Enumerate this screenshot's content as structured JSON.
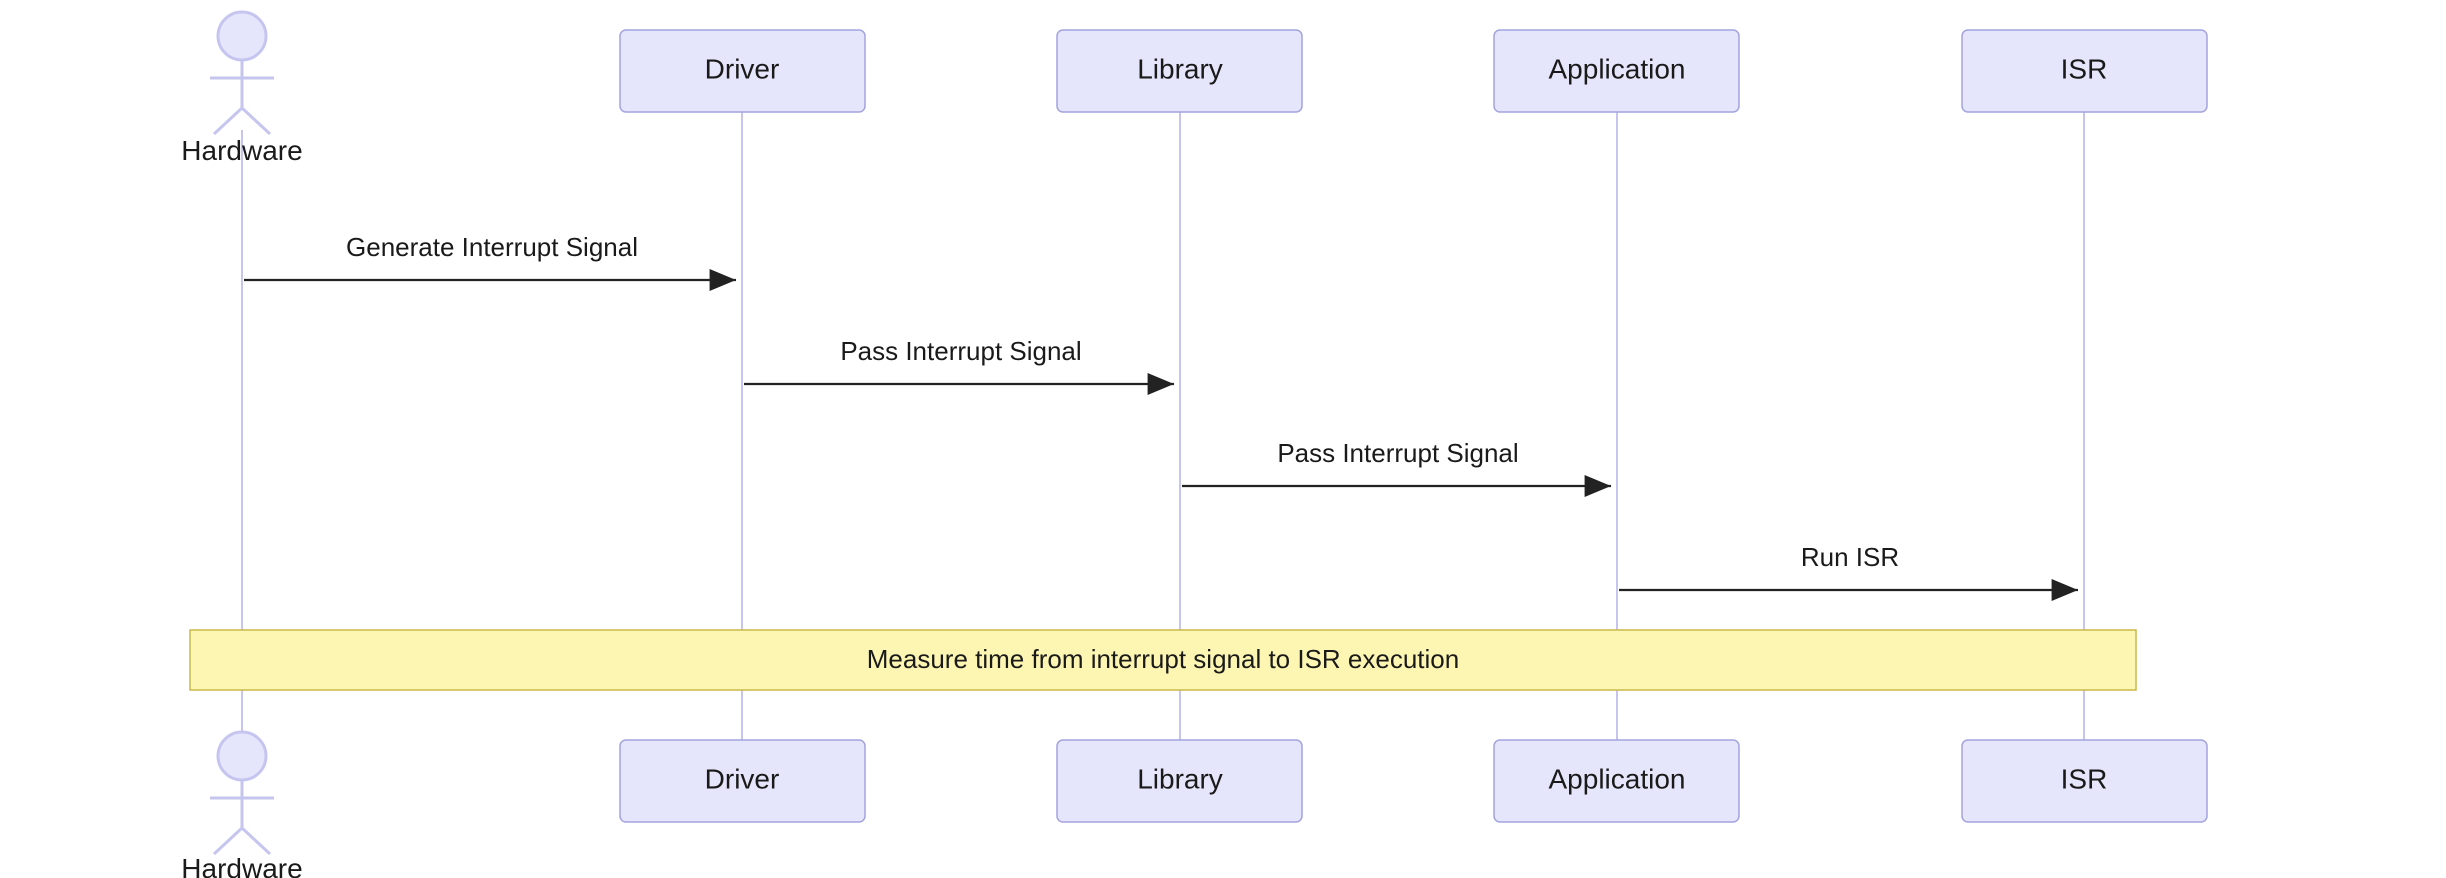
{
  "diagram": {
    "type": "sequence",
    "actor": {
      "name": "Hardware"
    },
    "participants": [
      {
        "id": "driver",
        "label": "Driver"
      },
      {
        "id": "library",
        "label": "Library"
      },
      {
        "id": "application",
        "label": "Application"
      },
      {
        "id": "isr",
        "label": "ISR"
      }
    ],
    "messages": [
      {
        "from": "hardware",
        "to": "driver",
        "label": "Generate Interrupt Signal"
      },
      {
        "from": "driver",
        "to": "library",
        "label": "Pass Interrupt Signal"
      },
      {
        "from": "library",
        "to": "application",
        "label": "Pass Interrupt Signal"
      },
      {
        "from": "application",
        "to": "isr",
        "label": "Run ISR"
      }
    ],
    "note": {
      "text": "Measure time from interrupt signal to ISR execution",
      "spans": [
        "hardware",
        "driver",
        "library",
        "application",
        "isr"
      ]
    }
  }
}
